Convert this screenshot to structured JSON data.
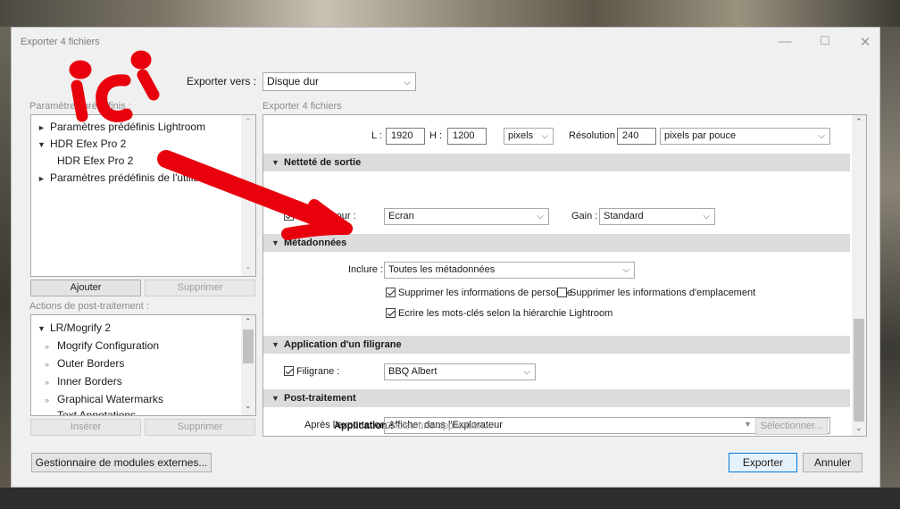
{
  "dialog": {
    "title": "Exporter 4 fichiers",
    "window_buttons": [
      "—",
      "☐",
      "✕"
    ]
  },
  "export_to": {
    "label": "Exporter vers :",
    "value": "Disque dur"
  },
  "presets": {
    "header": "Paramètres prédéfinis :",
    "items": [
      {
        "marker": "►",
        "label": "Paramètres prédéfinis Lightroom"
      },
      {
        "marker": "▼",
        "label": "HDR Efex Pro 2"
      },
      {
        "marker": "",
        "label": "HDR Efex Pro 2"
      },
      {
        "marker": "►",
        "label": "Paramètres prédéfinis de l'utilisateur"
      }
    ],
    "add_label": "Ajouter",
    "remove_label": "Supprimer"
  },
  "post_actions": {
    "header": "Actions de post-traitement :",
    "items": [
      {
        "marker": "▼",
        "label": "LR/Mogrify 2"
      },
      {
        "marker": "»",
        "label": "Mogrify Configuration"
      },
      {
        "marker": "»",
        "label": "Outer Borders"
      },
      {
        "marker": "»",
        "label": "Inner Borders"
      },
      {
        "marker": "»",
        "label": "Graphical Watermarks"
      },
      {
        "marker": "»",
        "label": "Text Annotations"
      }
    ],
    "insert_label": "Insérer",
    "remove_label": "Supprimer"
  },
  "main": {
    "header": "Exporter 4 fichiers",
    "size": {
      "l_label": "L :",
      "l_value": "1920",
      "h_label": "H :",
      "h_value": "1200",
      "unit": "pixels",
      "resolution_label": "Résolution :",
      "resolution_value": "240",
      "resolution_unit": "pixels par pouce"
    },
    "sharpening": {
      "title": "Netteté de sortie",
      "checkbox_label": "Netteté pour :",
      "for_value": "Ecran",
      "gain_label": "Gain :",
      "gain_value": "Standard"
    },
    "metadata": {
      "title": "Métadonnées",
      "include_label": "Inclure :",
      "include_value": "Toutes les métadonnées",
      "remove_person": "Supprimer les informations de personne",
      "remove_location": "Supprimer les informations d'emplacement",
      "keywords": "Ecrire les mots-clés selon la hiérarchie Lightroom"
    },
    "watermark": {
      "title": "Application d'un filigrane",
      "checkbox_label": "Filigrane :",
      "value": "BBQ Albert"
    },
    "post_processing": {
      "title": "Post-traitement",
      "after_label": "Après l'exportation :",
      "after_value": "Afficher dans l'Explorateur",
      "app_label": "Application :",
      "app_placeholder": "Choisir une application...",
      "choose_label": "Sélectionner..."
    }
  },
  "footer": {
    "plugin_manager": "Gestionnaire de modules externes...",
    "export": "Exporter",
    "cancel": "Annuler"
  },
  "annotation": {
    "handwritten_text": "ici",
    "color": "#e8000c"
  }
}
